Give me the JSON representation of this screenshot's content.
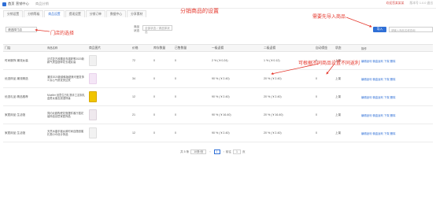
{
  "header": {
    "crumb_home": "首页",
    "crumb_section": "营销中心",
    "crumb_page": "商品分销",
    "right_user": "欢迎您某某某",
    "right_info": "版本号 1.0.0  退出"
  },
  "tabs": [
    {
      "label": "分销设置"
    },
    {
      "label": "分销等级"
    },
    {
      "label": "商品设置"
    },
    {
      "label": "提现设置"
    },
    {
      "label": "分销订单"
    },
    {
      "label": "数据中心"
    },
    {
      "label": "分享素材"
    }
  ],
  "filters": {
    "store_value": "请选择门店",
    "status_label": "商品状态",
    "status_placeholder": "全部状态 / 请选择状态",
    "import_label": "导入",
    "search_placeholder": "请输入商品名称查询"
  },
  "table": {
    "headers": [
      "门店",
      "商品名称",
      "商品图片",
      "价格",
      "库存数量",
      "已售数量",
      "一级返佣",
      "二级返佣",
      "自动佣金",
      "状态",
      "操作"
    ],
    "rows": [
      {
        "store": "时尚服饰 潮流女装",
        "name": "法式复古收腰连衣裙夏季2020新款气质显瘦碎花长裙女装",
        "price": "72",
        "stock": "0",
        "sold": "0",
        "lv1": "2 % ( ¥ 0.24)",
        "lv2": "1 % ( ¥ 0.12)",
        "comm": "0",
        "status": "上架",
        "ops": "编辑返利  佣金返利  下架  删除"
      },
      {
        "store": "优选饰品 潮流精选",
        "name": "潮流2020新款韩版甜美可爱发饰少女心气质发夹边夹",
        "price": "34",
        "stock": "0",
        "sold": "0",
        "lv1": "90 % ( ¥ 2.40)",
        "lv2": "20 % ( ¥ 2.40)",
        "comm": "0",
        "status": "上架",
        "ops": "编辑返利  佣金返利  下架  删除"
      },
      {
        "store": "优选礼品 精品推荐",
        "name": "Mueller 创意生日礼物手工定制礼盒男女朋友浪漫惊喜",
        "price": "12",
        "stock": "0",
        "sold": "0",
        "lv1": "90 % ( ¥ 2.40)",
        "lv2": "20 % ( ¥ 2.40)",
        "comm": "0",
        "status": "上架",
        "ops": "编辑返利  佣金返利  下架  删除"
      },
      {
        "store": "家居用品 生活馆",
        "name": "简约北欧陶瓷花瓶摆件客厅插花装饰品创意家居饰品",
        "price": "21",
        "stock": "0",
        "sold": "0",
        "lv1": "90 % ( ¥ 16.40)",
        "lv2": "20 % ( ¥ 16.40)",
        "comm": "0",
        "status": "上架",
        "ops": "编辑返利  佣金返利  下架  删除"
      },
      {
        "store": "家居用品 生活馆",
        "name": "天然水晶手链女款时尚百搭闺蜜礼物小众设计饰品",
        "price": "12",
        "stock": "0",
        "sold": "0",
        "lv1": "90 % ( ¥ 2.40)",
        "lv2": "20 % ( ¥ 2.40)",
        "comm": "0",
        "status": "上架",
        "ops": "编辑返利  佣金返利  下架  删除"
      }
    ]
  },
  "pagination": {
    "total": "共 5 条",
    "page_size": "10条/页",
    "current_page": "1",
    "goto_label": "前往",
    "goto_value": "1",
    "page_unit": "页"
  },
  "annotations": {
    "title": "分销商品的设置",
    "store": "门店的选择",
    "import": "需要先导入商品",
    "levels": "可根据不同商品设置不同返利"
  },
  "colors": {
    "accent": "#2f6fd6",
    "annotation": "#e5382d"
  }
}
